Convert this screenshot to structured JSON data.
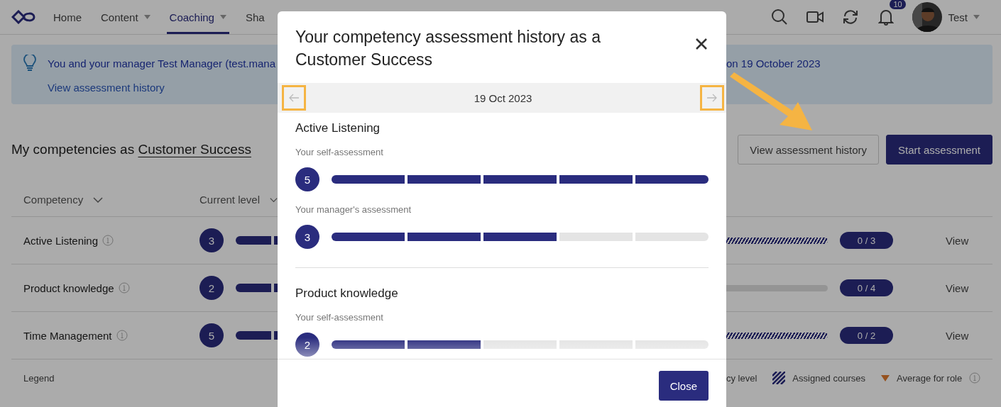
{
  "nav": {
    "items": [
      {
        "label": "Home",
        "selected": false,
        "dropdown": false
      },
      {
        "label": "Content",
        "selected": false,
        "dropdown": true
      },
      {
        "label": "Coaching",
        "selected": true,
        "dropdown": true
      },
      {
        "label": "Sha",
        "selected": false,
        "dropdown": false
      }
    ],
    "notifications": "10",
    "user": "Test"
  },
  "banner": {
    "text_start": "You and your manager Test Manager (test.mana",
    "text_end": "on 19 October 2023",
    "link": "View assessment history"
  },
  "heading": {
    "text": "My competencies as",
    "role": "Customer Success"
  },
  "actions": [
    {
      "label": "View assessment history",
      "kind": "secondary"
    },
    {
      "label": "Start assessment",
      "kind": "primary"
    }
  ],
  "table": {
    "columns": [
      {
        "label": "Competency"
      },
      {
        "label": "Current level"
      }
    ],
    "rows": [
      {
        "name": "Active Listening",
        "score": "3",
        "assigned_courses": true,
        "courses": "0 / 3",
        "action": "View"
      },
      {
        "name": "Product knowledge",
        "score": "2",
        "assigned_courses": false,
        "courses": "0 / 4",
        "action": "View"
      },
      {
        "name": "Time Management",
        "score": "5",
        "assigned_courses": true,
        "courses": "0 / 2",
        "action": "View"
      }
    ]
  },
  "legend": {
    "title": "Legend",
    "items": [
      {
        "kind": "text",
        "label": "cy level"
      },
      {
        "kind": "hatch",
        "label": "Assigned courses"
      },
      {
        "kind": "average",
        "label": "Average for role"
      }
    ]
  },
  "modal": {
    "title": "Your competency assessment history as a Customer Success",
    "date": "19 Oct 2023",
    "prev": {
      "disabled": true,
      "highlighted": true
    },
    "next": {
      "disabled": true,
      "highlighted": true
    },
    "sections": [
      {
        "title": "Active Listening",
        "assessments": [
          {
            "label": "Your self-assessment",
            "score": "5"
          },
          {
            "label": "Your manager's assessment",
            "score": "3"
          }
        ]
      },
      {
        "title": "Product knowledge",
        "assessments": [
          {
            "label": "Your self-assessment",
            "score": "2"
          }
        ]
      }
    ],
    "close": "Close"
  }
}
